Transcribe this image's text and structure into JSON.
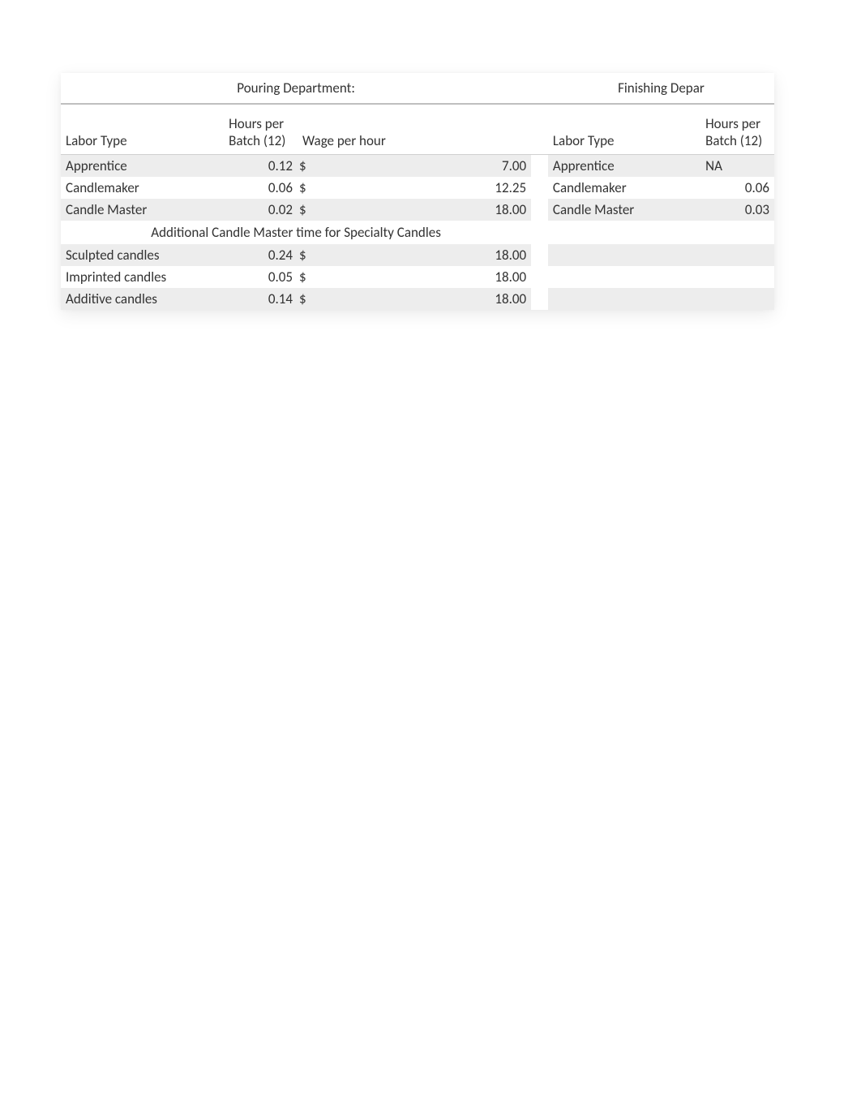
{
  "pouring": {
    "title": "Pouring Department:",
    "headers": {
      "labor_type": "Labor Type",
      "hours": "Hours per Batch (12)",
      "wage": "Wage per hour"
    },
    "rows": [
      {
        "label": "Apprentice",
        "hours": "0.12",
        "cur": "$",
        "wage": "7.00"
      },
      {
        "label": "Candlemaker",
        "hours": "0.06",
        "cur": "$",
        "wage": "12.25"
      },
      {
        "label": "Candle Master",
        "hours": "0.02",
        "cur": "$",
        "wage": "18.00"
      }
    ],
    "specialty_title": "Additional Candle Master time for Specialty Candles",
    "specialty_rows": [
      {
        "label": "Sculpted candles",
        "hours": "0.24",
        "cur": "$",
        "wage": "18.00"
      },
      {
        "label": "Imprinted candles",
        "hours": "0.05",
        "cur": "$",
        "wage": "18.00"
      },
      {
        "label": "Additive candles",
        "hours": "0.14",
        "cur": "$",
        "wage": "18.00"
      }
    ]
  },
  "finishing": {
    "title": "Finishing Depar",
    "headers": {
      "labor_type": "Labor Type",
      "hours": "Hours per Batch (12)"
    },
    "rows": [
      {
        "label": "Apprentice",
        "hours": "NA"
      },
      {
        "label": "Candlemaker",
        "hours": "0.06"
      },
      {
        "label": "Candle Master",
        "hours": "0.03"
      }
    ]
  }
}
